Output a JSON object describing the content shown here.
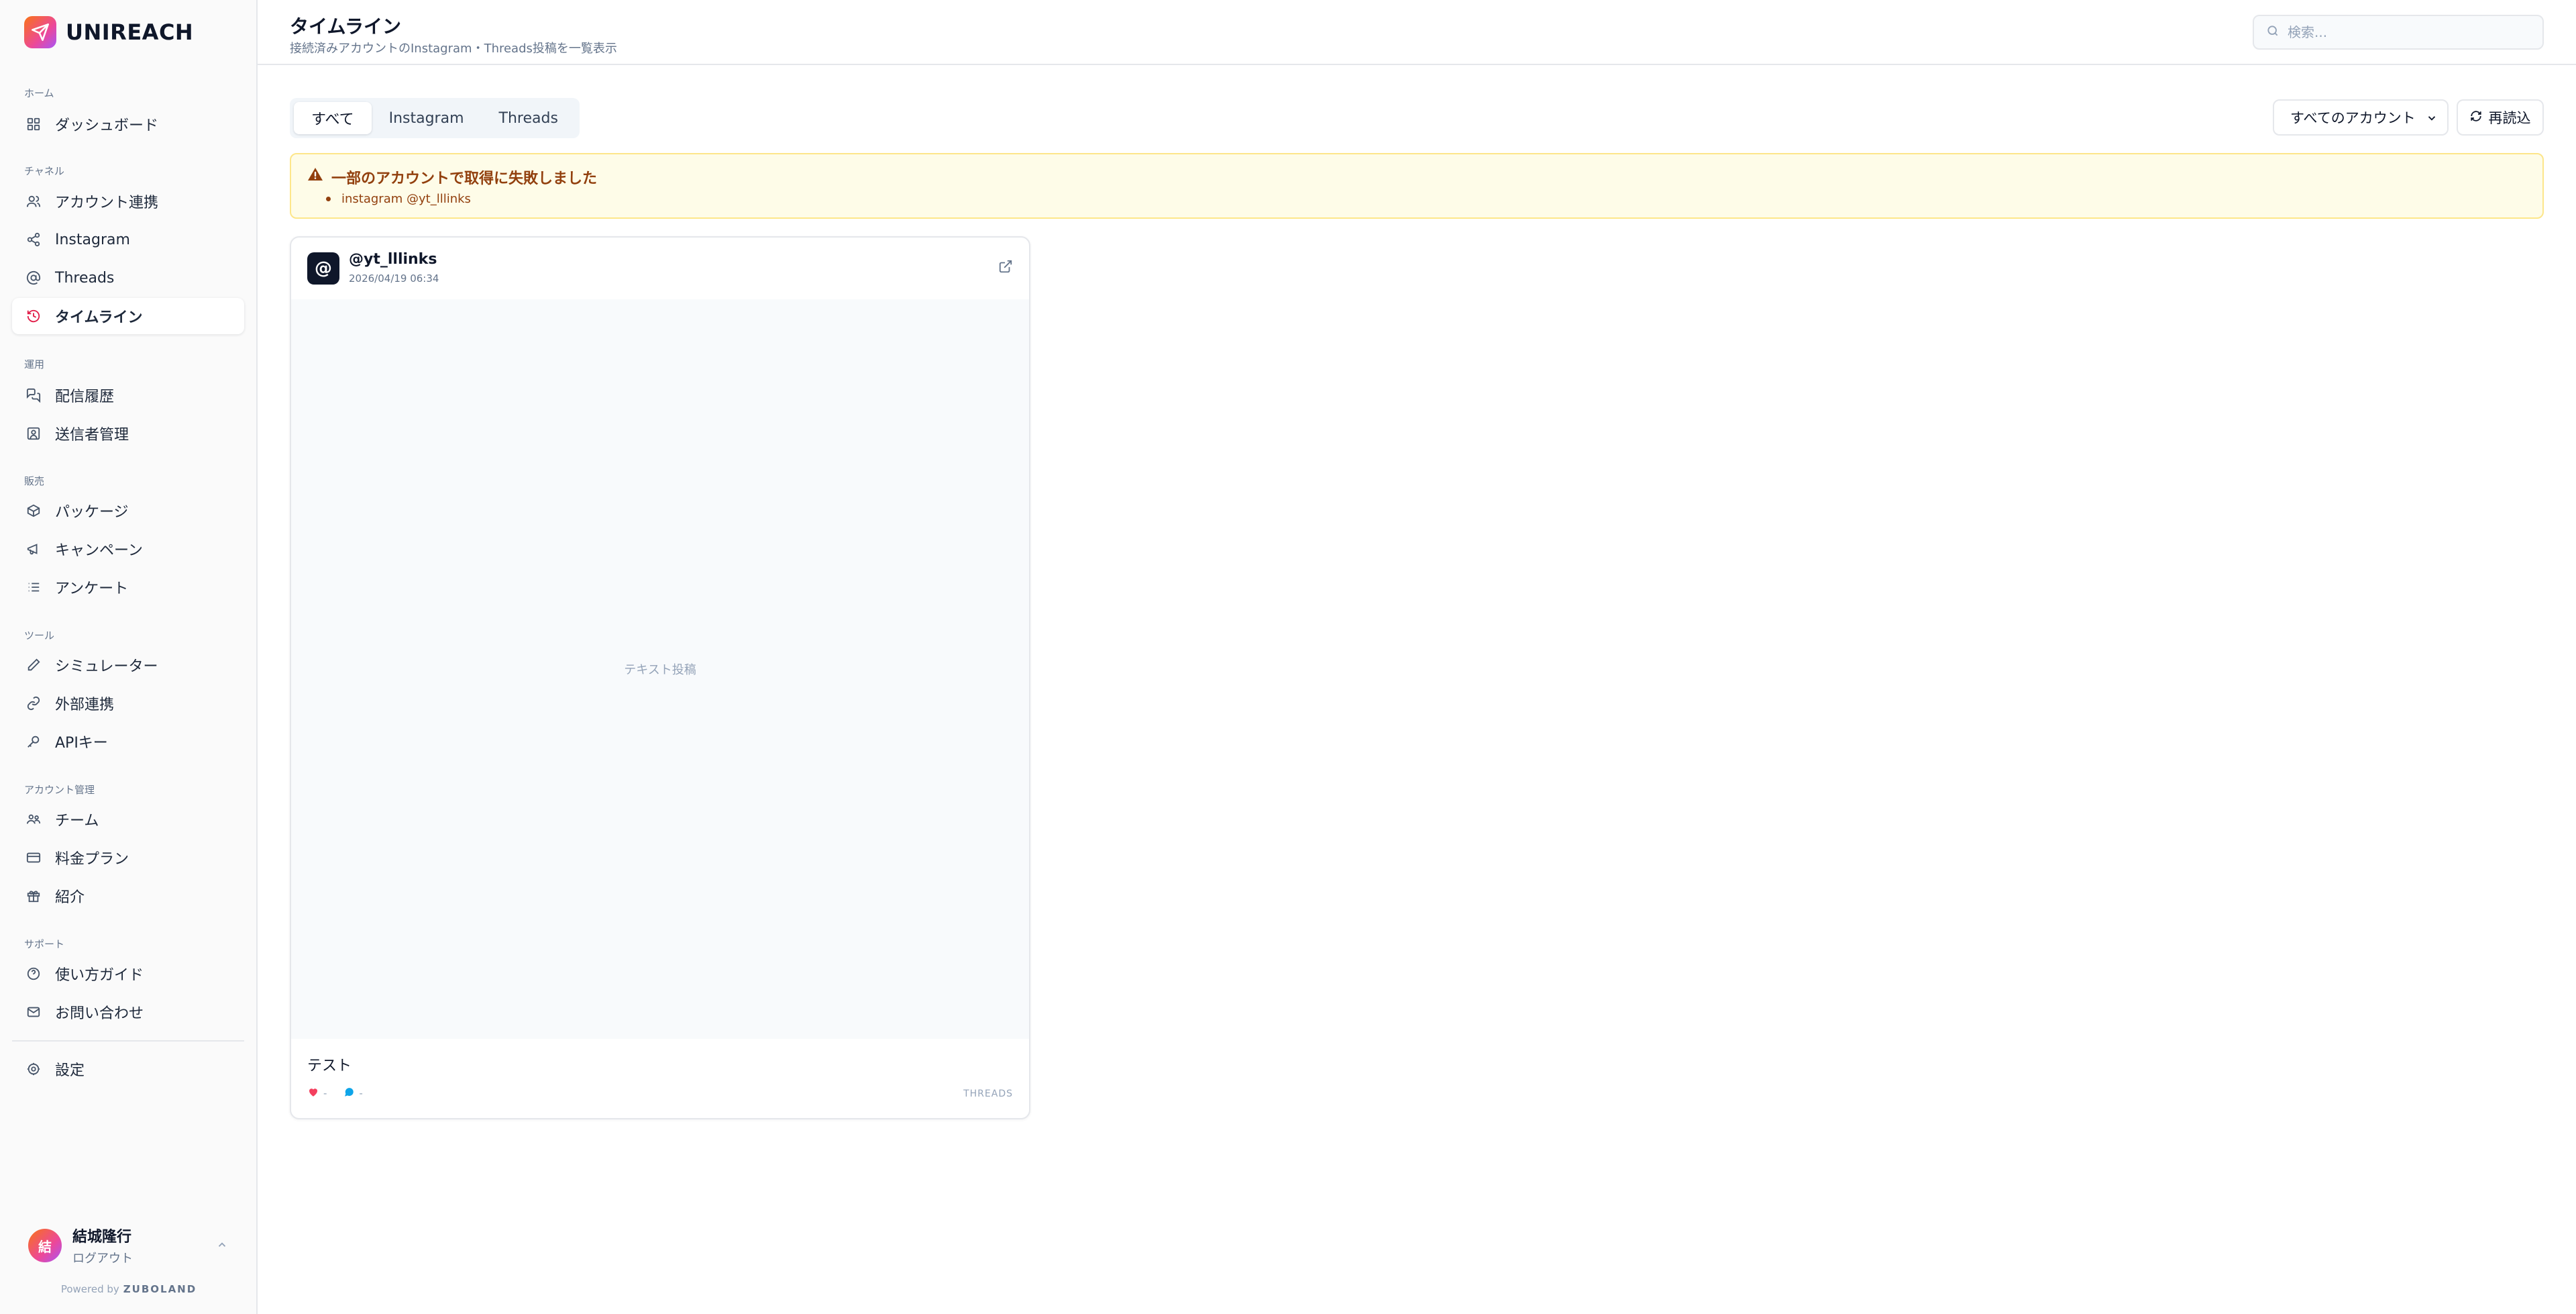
{
  "brand": {
    "name": "UNIREACH"
  },
  "nav": {
    "sections": [
      {
        "label": "ホーム"
      },
      {
        "label": "チャネル"
      },
      {
        "label": "運用"
      },
      {
        "label": "販売"
      },
      {
        "label": "ツール"
      },
      {
        "label": "アカウント管理"
      },
      {
        "label": "サポート"
      }
    ],
    "items": [
      {
        "label": "ダッシュボード",
        "icon": "grid-icon"
      },
      {
        "label": "アカウント連携",
        "icon": "users-icon"
      },
      {
        "label": "Instagram",
        "icon": "share-icon"
      },
      {
        "label": "Threads",
        "icon": "at-icon"
      },
      {
        "label": "タイムライン",
        "icon": "history-icon",
        "active": true
      },
      {
        "label": "配信履歴",
        "icon": "messages-icon"
      },
      {
        "label": "送信者管理",
        "icon": "contact-icon"
      },
      {
        "label": "パッケージ",
        "icon": "package-icon"
      },
      {
        "label": "キャンペーン",
        "icon": "megaphone-icon"
      },
      {
        "label": "アンケート",
        "icon": "list-icon"
      },
      {
        "label": "シミュレーター",
        "icon": "pen-icon"
      },
      {
        "label": "外部連携",
        "icon": "link-icon"
      },
      {
        "label": "APIキー",
        "icon": "key-icon"
      },
      {
        "label": "チーム",
        "icon": "team-icon"
      },
      {
        "label": "料金プラン",
        "icon": "card-icon"
      },
      {
        "label": "紹介",
        "icon": "gift-icon"
      },
      {
        "label": "使い方ガイド",
        "icon": "help-icon"
      },
      {
        "label": "お問い合わせ",
        "icon": "mail-icon"
      },
      {
        "label": "設定",
        "icon": "gear-icon"
      }
    ]
  },
  "user": {
    "initial": "結",
    "name": "結城隆行",
    "logout": "ログアウト"
  },
  "powered": {
    "prefix": "Powered by",
    "brand": "ZUBOLAND"
  },
  "header": {
    "title": "タイムライン",
    "subtitle": "接続済みアカウントのInstagram・Threads投稿を一覧表示",
    "search_placeholder": "検索..."
  },
  "toolbar": {
    "tabs": [
      {
        "label": "すべて",
        "active": true
      },
      {
        "label": "Instagram"
      },
      {
        "label": "Threads"
      }
    ],
    "account_select": "すべてのアカウント",
    "reload_label": "再読込"
  },
  "alert": {
    "title": "一部のアカウントで取得に失敗しました",
    "items": [
      "instagram @yt_lllinks"
    ]
  },
  "post": {
    "avatar_glyph": "@",
    "username": "@yt_lllinks",
    "date": "2026/04/19 06:34",
    "media_placeholder": "テキスト投稿",
    "text": "テスト",
    "likes": "-",
    "replies": "-",
    "platform": "THREADS"
  },
  "colors": {
    "accent_gradient_start": "#f97316",
    "accent_gradient_end": "#a855f7",
    "alert_bg": "#fefce8",
    "alert_text": "#92400e",
    "active_nav_icon": "#e11d48",
    "like_color": "#f43f5e",
    "reply_color": "#0ea5e9"
  }
}
